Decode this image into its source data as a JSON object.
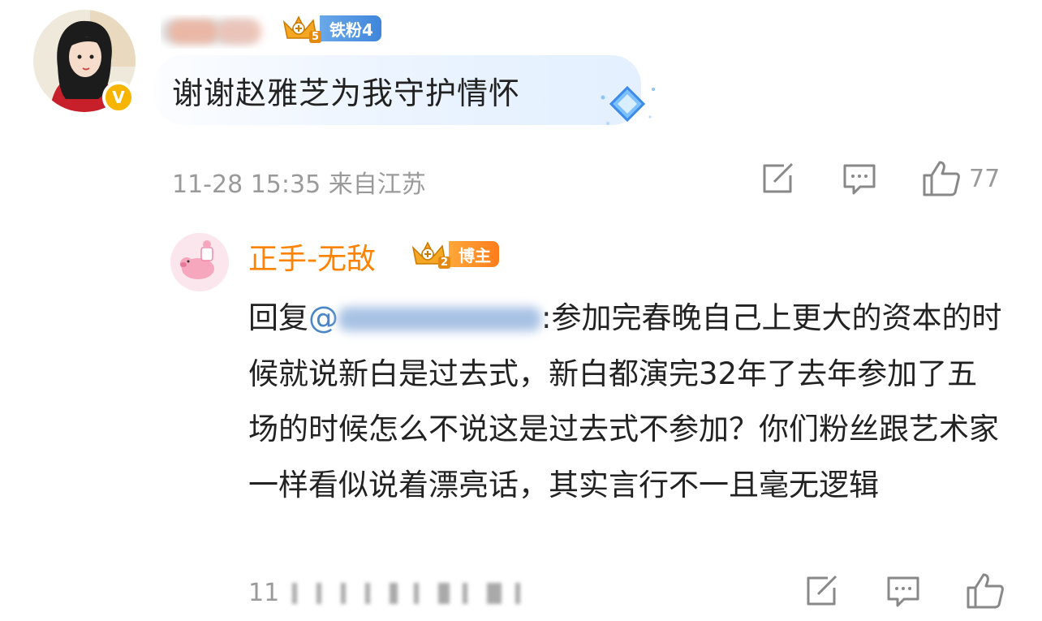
{
  "comment": {
    "avatar_icon": "user-avatar-girl",
    "verified_icon": "verified-v-icon",
    "verified_mark": "V",
    "fan_badge": {
      "level": "5",
      "label": "铁粉4",
      "icon": "crown-icon"
    },
    "text": "谢谢赵雅芝为我守护情怀",
    "meta": "11-28 15:35 来自江苏",
    "actions": {
      "share_icon": "share-icon",
      "reply_icon": "comment-icon",
      "like_icon": "like-icon",
      "like_count": "77"
    }
  },
  "reply": {
    "avatar_icon": "pig-avatar",
    "username": "正手-无敌",
    "host_badge": {
      "level": "2",
      "label": "博主",
      "icon": "crown-icon"
    },
    "reply_prefix": "回复",
    "mention_at": "@",
    "text_after_mention": ":参加完春晚自己上更大的资本的时候就说新白是过去式，新白都演完32年了去年参加了五场的时候怎么不说这是过去式不参加？你们粉丝跟艺术家一样看似说着漂亮话，其实言行不一且毫无逻辑",
    "meta_visible": "11",
    "actions": {
      "share_icon": "share-icon",
      "reply_icon": "comment-icon",
      "like_icon": "like-icon"
    }
  },
  "colors": {
    "username_orange": "#ff8200",
    "mention_blue": "#4b86c8",
    "meta_gray": "#9a9a9a",
    "text_dark": "#222222",
    "verified_yellow": "#f7b500"
  }
}
